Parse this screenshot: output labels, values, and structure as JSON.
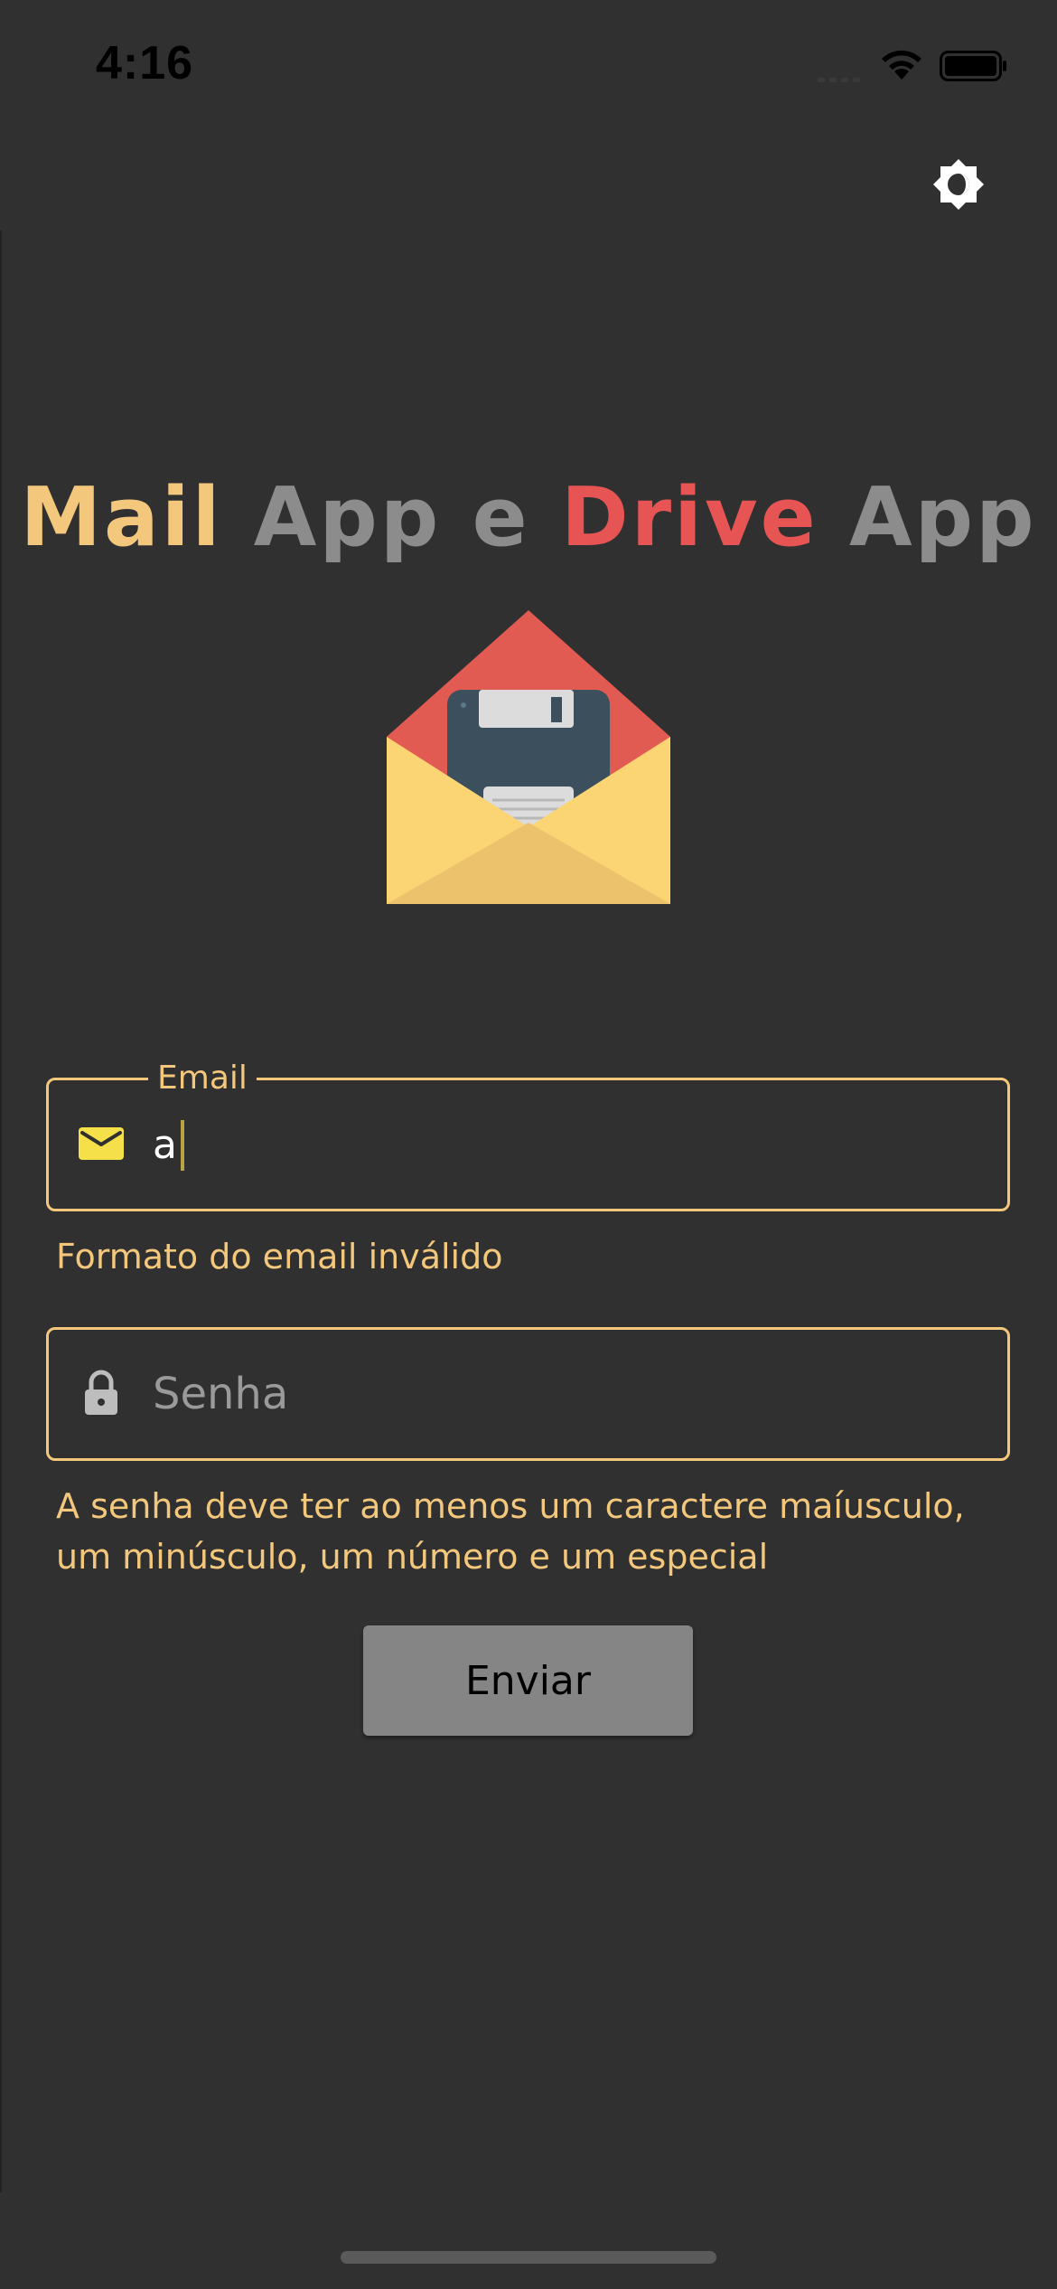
{
  "status_bar": {
    "time": "4:16"
  },
  "header": {
    "theme_toggle_icon": "brightness-icon"
  },
  "title": {
    "part_mail": "Mail",
    "part_app1": "App",
    "part_e": "e",
    "part_drive": "Drive",
    "part_app2": "App",
    "colors": {
      "mail": "#F3C77C",
      "neutral": "#8C8C8C",
      "drive": "#E65454"
    }
  },
  "logo": {
    "icon": "envelope-floppy-logo"
  },
  "form": {
    "email": {
      "label": "Email",
      "value": "a",
      "icon": "mail-icon",
      "error": "Formato do email inválido"
    },
    "password": {
      "placeholder": "Senha",
      "icon": "lock-icon",
      "error": "A senha deve ter ao menos um caractere maíusculo, um minúsculo, um número e um especial"
    },
    "submit_label": "Enviar"
  },
  "colors": {
    "background": "#303030",
    "accent": "#F3C77C",
    "button": "#858585"
  }
}
